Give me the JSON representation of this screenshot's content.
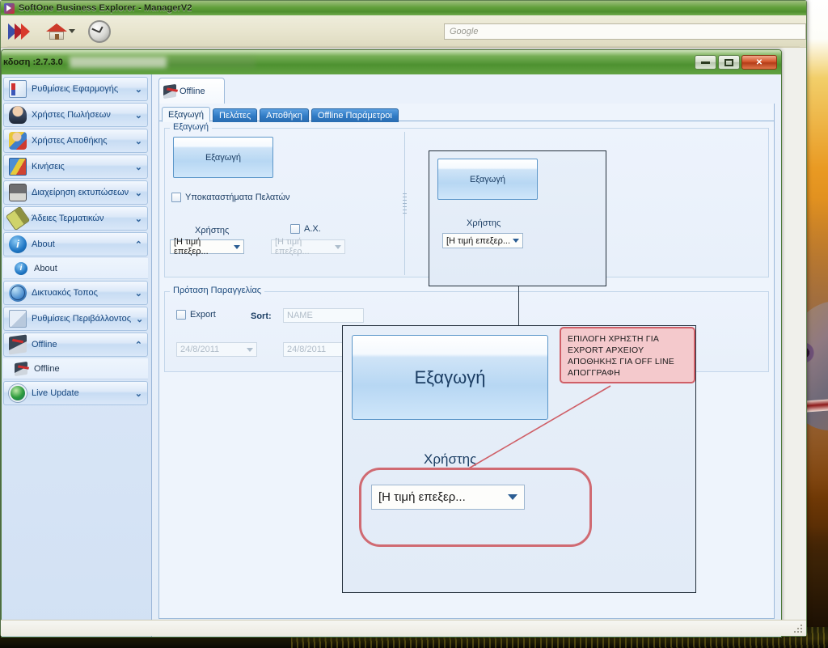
{
  "app": {
    "title": "SoftOne Business Explorer - ManagerV2",
    "title_icon": "softone-logo-icon",
    "toolbar": {
      "logo_icon": "softone-chevrons-icon",
      "home_icon": "home-icon",
      "home_caret_icon": "chevron-down-icon",
      "clock_icon": "clock-icon",
      "search_placeholder": "Google",
      "search_value": ""
    }
  },
  "inner_window": {
    "version_text": "κδοση :2.7.3.0",
    "minimize_label": "",
    "restore_label": "",
    "close_label": "✕",
    "minimize_icon": "minimize-icon",
    "restore_icon": "restore-icon",
    "close_icon": "close-icon"
  },
  "sidebar": {
    "items": [
      {
        "label": "Ρυθμίσεις Εφαρμογής",
        "icon": "app-settings-icon",
        "chevron": "⌄",
        "type": "group"
      },
      {
        "label": "Χρήστες Πωλήσεων",
        "icon": "sales-users-icon",
        "chevron": "⌄",
        "type": "group"
      },
      {
        "label": "Χρήστες Αποθήκης",
        "icon": "warehouse-users-icon",
        "chevron": "⌄",
        "type": "group"
      },
      {
        "label": "Κινήσεις",
        "icon": "transactions-icon",
        "chevron": "⌄",
        "type": "group"
      },
      {
        "label": "Διαχείρηση εκτυπώσεων",
        "icon": "print-management-icon",
        "chevron": "⌄",
        "type": "group"
      },
      {
        "label": "Άδειες Τερματικών",
        "icon": "terminal-licenses-icon",
        "chevron": "⌄",
        "type": "group"
      },
      {
        "label": "About",
        "icon": "about-icon",
        "chevron": "⌃",
        "type": "group"
      },
      {
        "label": "About",
        "icon": "about-small-icon",
        "type": "sub"
      },
      {
        "label": "Δικτυακός Τοπος",
        "icon": "website-icon",
        "chevron": "⌄",
        "type": "group"
      },
      {
        "label": "Ρυθμίσεις Περιβάλλοντος",
        "icon": "environment-settings-icon",
        "chevron": "⌄",
        "type": "group"
      },
      {
        "label": "Offline",
        "icon": "offline-icon",
        "chevron": "⌃",
        "type": "group"
      },
      {
        "label": "Offline",
        "icon": "offline-small-icon",
        "type": "sub"
      },
      {
        "label": "Live Update",
        "icon": "live-update-icon",
        "chevron": "⌄",
        "type": "group"
      }
    ]
  },
  "document_tab": {
    "label": "Offline",
    "icon": "offline-icon"
  },
  "tabs": [
    {
      "label": "Εξαγωγή",
      "active": true
    },
    {
      "label": "Πελάτες",
      "active": false
    },
    {
      "label": "Αποθήκη",
      "active": false
    },
    {
      "label": "Offline Παράμετροι",
      "active": false
    }
  ],
  "export_group": {
    "title": "Εξαγωγή",
    "export_button": "Εξαγωγή",
    "branches_checkbox": {
      "label": "Υποκαταστήματα Πελατών",
      "checked": false
    },
    "user_label": "Χρήστης",
    "user_combo_value": "[Η τιμή επεξερ...",
    "ax_checkbox": {
      "label": "Α.Χ.",
      "checked": false
    },
    "ax_combo_value": "[Η τιμή επεξερ..."
  },
  "order_group": {
    "title": "Πρόταση Παραγγελίας",
    "export_checkbox": {
      "label": "Export",
      "checked": false
    },
    "sort_label": "Sort:",
    "sort_value": "NAME",
    "date_from": "24/8/2011",
    "date_to": "24/8/2011"
  },
  "zoom_small": {
    "export_button": "Εξαγωγή",
    "user_label": "Χρήστης",
    "user_combo_value": "[Η τιμή επεξερ..."
  },
  "zoom_big": {
    "export_button": "Εξαγωγή",
    "user_label": "Χρήστης",
    "user_combo_value": "[Η τιμή επεξερ..."
  },
  "annotation": {
    "text": "ΕΠΙΛΟΓΗ ΧΡΗΣΤΗ ΓΙΑ EXPORT ΑΡΧΕΙΟΥ ΑΠΟΘΗΚΗΣ ΓΙΑ OFF LINE ΑΠΟΓΓΡΑΦΗ",
    "border_color": "#cf5f67",
    "fill_color": "#f4c9cc"
  },
  "colors": {
    "title_green": "#4d9130",
    "accent_blue": "#2f7ac4",
    "panel_blue": "#eef4fc",
    "callout_red": "#cf5f67",
    "desktop_orange": "#e99a23"
  }
}
